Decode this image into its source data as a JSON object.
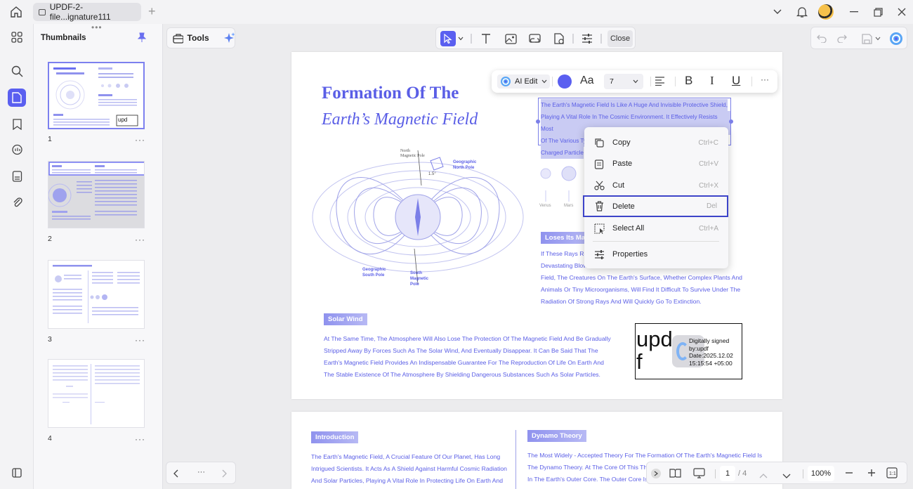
{
  "window": {
    "tab_title": "UPDF-2-file...ignature111"
  },
  "left_panel": {
    "title": "Thumbnails",
    "thumbnails": [
      {
        "page": "1"
      },
      {
        "page": "2"
      },
      {
        "page": "3"
      },
      {
        "page": "4"
      }
    ],
    "more": "···"
  },
  "toolbar": {
    "tools_label": "Tools",
    "close_label": "Close"
  },
  "float_bar": {
    "ai_edit_label": "AI Edit",
    "font_label": "Aa",
    "font_size": "7",
    "bold": "B",
    "italic": "I",
    "underline": "U",
    "more": "···",
    "text_color": "#5a5ff0"
  },
  "context_menu": {
    "items": [
      {
        "label": "Copy",
        "shortcut": "Ctrl+C"
      },
      {
        "label": "Paste",
        "shortcut": "Ctrl+V"
      },
      {
        "label": "Cut",
        "shortcut": "Ctrl+X"
      },
      {
        "label": "Delete",
        "shortcut": "Del"
      },
      {
        "label": "Select All",
        "shortcut": "Ctrl+A"
      },
      {
        "label": "Properties",
        "shortcut": ""
      }
    ]
  },
  "page1": {
    "title_line1": "Formation Of The",
    "title_line2": "Earth’s Magnetic Field",
    "selected_text": [
      "The Earth's Magnetic Field Is Like A Huge And Invisible Protective Shield,",
      "Playing A Vital Role In The Cosmic Environment. It Effectively Resists Most",
      "Of The Various Ty",
      "Charged Particle"
    ],
    "diagram_labels": {
      "north_magnetic": "North Magnetic Pole",
      "geo_north": "Geographic North Pole",
      "geo_south": "Geographic South Pole",
      "south_magnetic": "South Magnetic Pole",
      "angle": "1.5°"
    },
    "planets": [
      "Venus",
      "Mars"
    ],
    "loses_tag": "Loses Its Ma",
    "loses_text": [
      "If These Rays Re",
      "Devastating Blow",
      "Field, The Creatures On The Earth's Surface, Whether Complex Plants And",
      "Animals Or Tiny Microorganisms, Will Find It Difficult To Survive Under The",
      "Radiation Of Strong Rays And Will Quickly Go To Extinction."
    ],
    "solar_tag": "Solar Wind",
    "solar_text": [
      "At The Same Time, The Atmosphere Will Also Lose The Protection Of The Magnetic Field And Be Gradually",
      "Stripped Away By Forces Such As The Solar Wind, And Eventually Disappear. It Can Be Said That The",
      "Earth's Magnetic Field Provides An Indispensable Guarantee For The Reproduction Of Life On Earth And",
      "The Stable Existence Of The Atmosphere By Shielding Dangerous Substances Such As Solar Particles."
    ],
    "signature": {
      "big_text_1": "upd",
      "big_text_2": "f",
      "line1": "Digitally signed",
      "line2": "by:updf",
      "line3": "Date:2025.12.02",
      "line4": "15:15:54 +05:00"
    }
  },
  "page2": {
    "intro_tag": "Introduction",
    "intro_text": [
      "The Earth's Magnetic Field, A Crucial Feature Of Our Planet, Has Long",
      "Intrigued Scientists. It Acts As A Shield Against Harmful Cosmic Radiation",
      "And Solar Particles, Playing A Vital Role In Protecting Life On Earth And"
    ],
    "dynamo_tag": "Dynamo Theory",
    "dynamo_text": [
      "The Most Widely - Accepted Theory For The Formation Of The Earth's Magnetic Field Is",
      "The Dynamo Theory. At The Core Of This Theor",
      "In The Earth's Outer Core. The Outer Core Is The"
    ]
  },
  "bottom": {
    "more": "···",
    "current_page": "1",
    "total_pages": "/ 4",
    "zoom": "100%"
  }
}
